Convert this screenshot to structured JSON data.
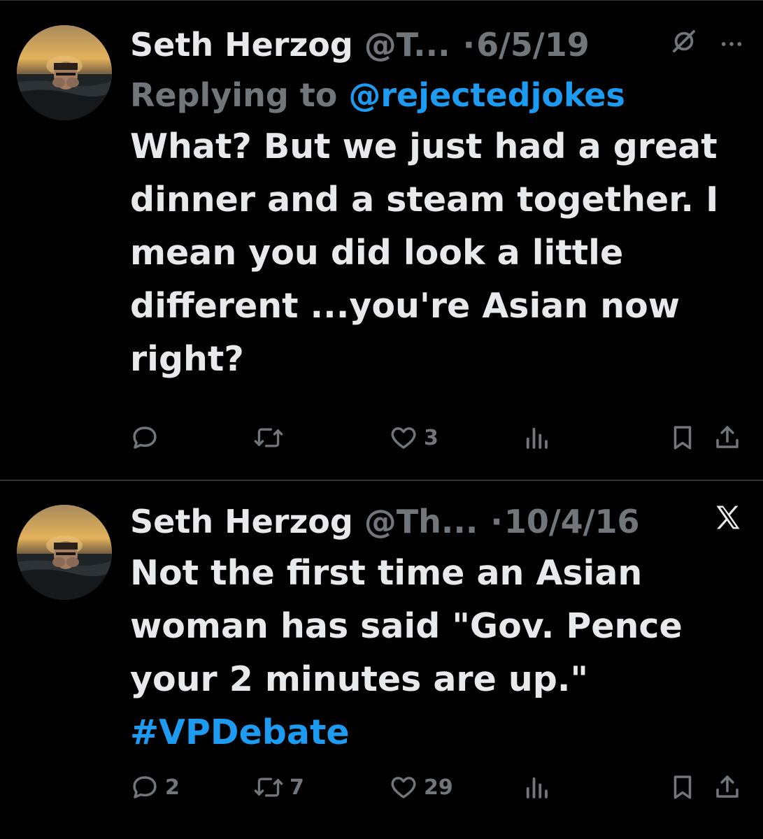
{
  "tweets": [
    {
      "name": "Seth Herzog",
      "handle": "@T...",
      "dot": "·",
      "date": "6/5/19",
      "replying_label": "Replying to ",
      "replying_to": "@rejectedjokes",
      "text": "What? But we just had a great dinner and a steam together. I mean you did look a little different ...you're Asian now right?",
      "reply_count": "",
      "retweet_count": "",
      "like_count": "3",
      "icons": [
        "no-bell-icon",
        "more-icon"
      ]
    },
    {
      "name": "Seth Herzog",
      "handle": "@Th...",
      "dot": "·",
      "date": "10/4/16",
      "text": "Not the first time an Asian woman has said \"Gov. Pence your 2 minutes are up.\"",
      "hashtag": "#VPDebate",
      "reply_count": "2",
      "retweet_count": "7",
      "like_count": "29",
      "icons": [
        "x-logo-icon"
      ]
    }
  ],
  "colors": {
    "background": "#000000",
    "text": "#e7e9ea",
    "muted": "#71767b",
    "link": "#1d9bf0",
    "divider": "#2f3336"
  }
}
